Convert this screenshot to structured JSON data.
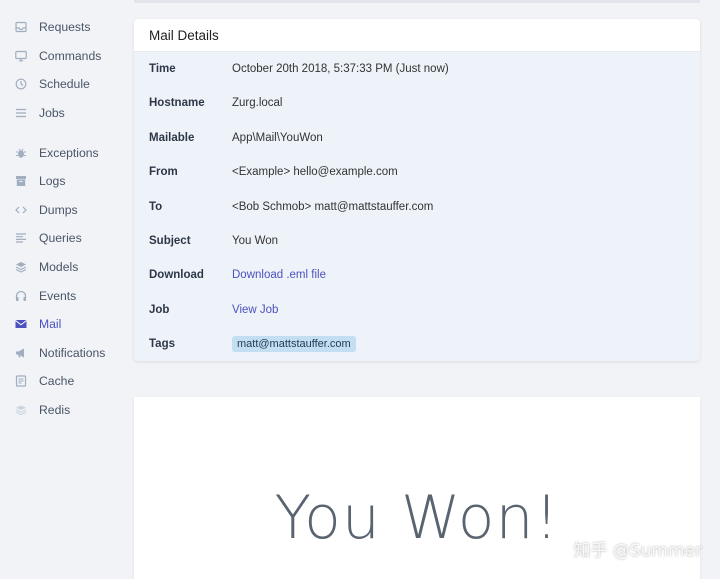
{
  "sidebar": {
    "items": [
      {
        "label": "Requests",
        "icon": "inbox-icon"
      },
      {
        "label": "Commands",
        "icon": "monitor-icon"
      },
      {
        "label": "Schedule",
        "icon": "clock-icon"
      },
      {
        "label": "Jobs",
        "icon": "list-icon"
      },
      {
        "label": "Exceptions",
        "icon": "bug-icon"
      },
      {
        "label": "Logs",
        "icon": "archive-icon"
      },
      {
        "label": "Dumps",
        "icon": "code-icon"
      },
      {
        "label": "Queries",
        "icon": "align-left-icon"
      },
      {
        "label": "Models",
        "icon": "layers-icon"
      },
      {
        "label": "Events",
        "icon": "headphones-icon"
      },
      {
        "label": "Mail",
        "icon": "envelope-icon",
        "active": true
      },
      {
        "label": "Notifications",
        "icon": "megaphone-icon"
      },
      {
        "label": "Cache",
        "icon": "file-text-icon"
      },
      {
        "label": "Redis",
        "icon": "stack-icon"
      }
    ]
  },
  "details": {
    "title": "Mail Details",
    "rows": [
      {
        "label": "Time",
        "value": "October 20th 2018, 5:37:33 PM (Just now)"
      },
      {
        "label": "Hostname",
        "value": "Zurg.local"
      },
      {
        "label": "Mailable",
        "value": "App\\Mail\\YouWon"
      },
      {
        "label": "From",
        "value": "<Example> hello@example.com"
      },
      {
        "label": "To",
        "value": "<Bob Schmob> matt@mattstauffer.com"
      },
      {
        "label": "Subject",
        "value": "You Won"
      },
      {
        "label": "Download",
        "value": "Download .eml file"
      },
      {
        "label": "Job",
        "value": "View Job"
      },
      {
        "label": "Tags",
        "value": "matt@mattstauffer.com"
      }
    ]
  },
  "preview": {
    "heading": "You Won!"
  },
  "watermark": "知乎 @Summer",
  "colors": {
    "accent": "#4c51bf",
    "tag_bg": "#c3ddf1",
    "page_bg": "#f1f3f6",
    "card_body": "#eef3f9"
  }
}
